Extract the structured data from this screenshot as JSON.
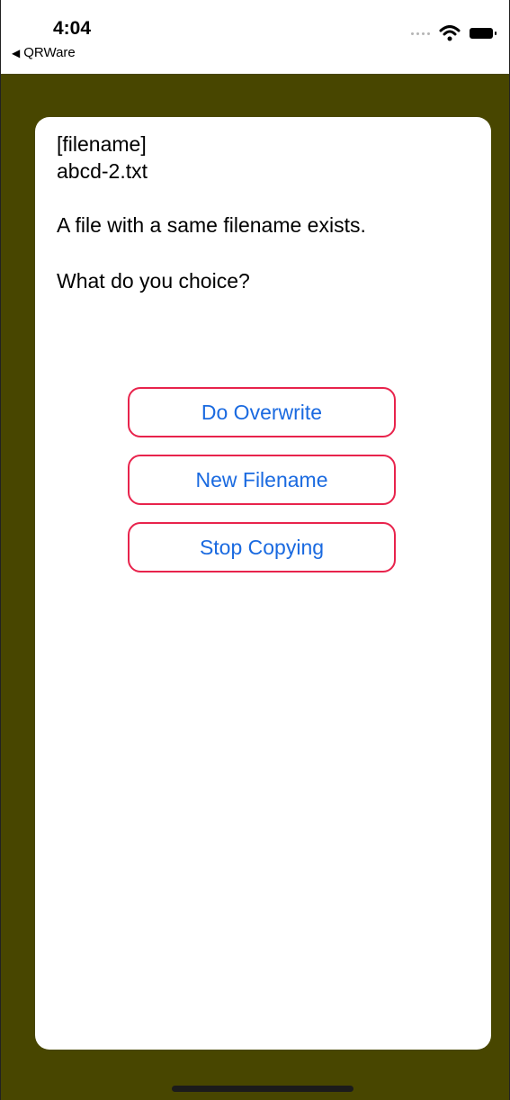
{
  "status_bar": {
    "time": "4:04",
    "back_app_label": "QRWare",
    "back_icon": "back-triangle-icon",
    "wifi_icon": "wifi-icon",
    "battery_icon": "battery-icon"
  },
  "colors": {
    "background": "#484600",
    "card": "#ffffff",
    "button_border": "#e8234c",
    "button_text": "#1a6ae0"
  },
  "dialog": {
    "filename_label": "[filename]",
    "filename_value": "abcd-2.txt",
    "message": "A file with a same filename exists.",
    "question": "What do you choice?",
    "buttons": [
      {
        "label": "Do Overwrite"
      },
      {
        "label": "New Filename"
      },
      {
        "label": "Stop Copying"
      }
    ]
  }
}
